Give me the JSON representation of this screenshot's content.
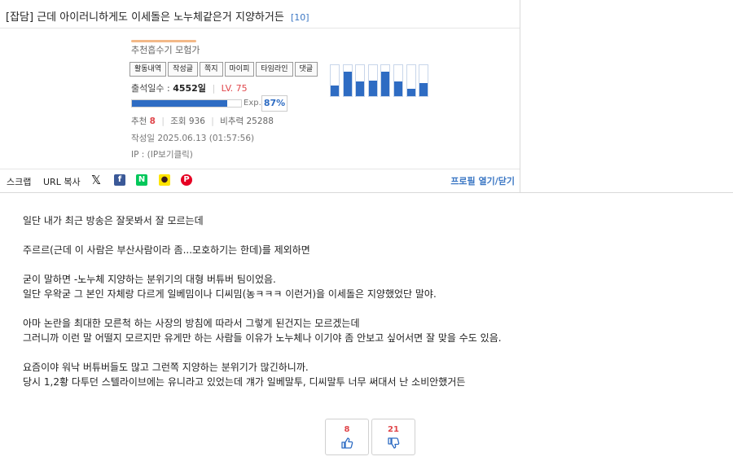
{
  "post": {
    "category": "[잡담]",
    "title": "근데 아이러니하게도 이세돌은 노누체같은거 지양하거든",
    "comment_count": "[10]"
  },
  "profile": {
    "nickname": "추천흡수기 모험가",
    "tabs": [
      "활동내역",
      "작성글",
      "쪽지",
      "마이피",
      "타임라인",
      "댓글"
    ],
    "attendance_label": "출석일수 :",
    "attendance_value": "4552일",
    "level": "LV. 75",
    "exp_label": "Exp.",
    "exp_percent": "87%",
    "exp_fraction": 0.87,
    "recommend_label": "추천",
    "recommend_value": "8",
    "views_label": "조회",
    "views_value": "936",
    "nonrec_label": "비추력",
    "nonrec_value": "25288",
    "written_date": "작성일 2025.06.13 (01:57:56)",
    "ip": "IP : (IP보기클릭)",
    "activity_levels": [
      0.35,
      0.78,
      0.48,
      0.5,
      0.78,
      0.48,
      0.25,
      0.42
    ]
  },
  "share": {
    "scrap": "스크랩",
    "url_copy": "URL 복사",
    "x_icon": "x-icon",
    "facebook": "f",
    "naver": "N",
    "kakao": "●",
    "pinterest": "P",
    "profile_toggle": "프로필 열기/닫기"
  },
  "body": {
    "paragraphs": [
      [
        "일단 내가 최근 방송은 잘못봐서 잘 모르는데"
      ],
      [
        "주르르(근데 이 사람은 부산사람이라 좀...모호하기는 한데)를 제외하면"
      ],
      [
        "굳이 말하면 -노누체 지양하는 분위기의 대형 버튜버 팀이었음.",
        "일단 우왁굳 그 본인 자체랑 다르게 일베밈이나 디씨밈(농ㅋㅋㅋ 이런거)을 이세돌은 지양했었단 말야."
      ],
      [
        "아마 논란을 최대한 모른척 하는 사장의 방침에 따라서 그렇게 된건지는 모르겠는데",
        "그러니까 이런 말 어떨지 모르지만 유게만 하는 사람들 이유가 노누체나 이기야 좀 안보고 싶어서면 잘 맞을 수도 있음."
      ],
      [
        "요즘이야 워낙 버튜버들도 많고 그런쪽 지양하는 분위기가 많긴하니까.",
        "당시 1,2황 다투던 스텔라이브에는 유니라고 있었는데 걔가 일베말투, 디씨말투 너무 써대서 난 소비안했거든"
      ]
    ]
  },
  "votes": {
    "up_count": "8",
    "down_count": "21",
    "accent": "#e0464b"
  },
  "colors": {
    "link_blue": "#3b77c4",
    "bar_blue": "#2e6cc3",
    "level_red": "#e0464b"
  }
}
